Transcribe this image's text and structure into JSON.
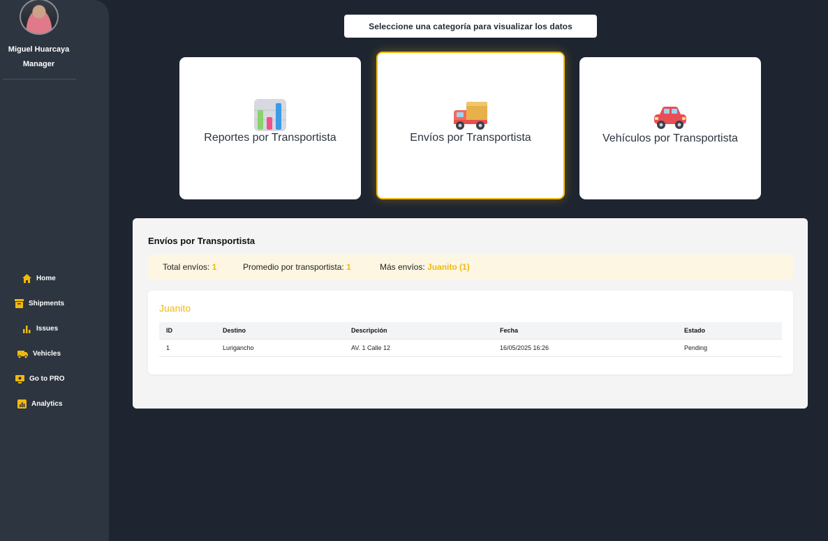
{
  "user": {
    "name": "Miguel Huarcaya",
    "role": "Manager"
  },
  "nav": [
    {
      "label": "Home",
      "icon": "home-icon"
    },
    {
      "label": "Shipments",
      "icon": "box-icon"
    },
    {
      "label": "Issues",
      "icon": "bar-chart-icon"
    },
    {
      "label": "Vehicles",
      "icon": "truck-icon"
    },
    {
      "label": "Go to PRO",
      "icon": "monitor-icon"
    },
    {
      "label": "Analytics",
      "icon": "analytics-icon"
    }
  ],
  "prompt": "Seleccione una categoría para visualizar los datos",
  "cards": [
    {
      "label": "Reportes por Transportista",
      "icon": "bar-chart-emoji-icon"
    },
    {
      "label": "Envíos por Transportista",
      "icon": "delivery-truck-emoji-icon",
      "selected": true
    },
    {
      "label": "Vehículos por Transportista",
      "icon": "car-emoji-icon"
    }
  ],
  "panel": {
    "title": "Envíos por Transportista",
    "summary": {
      "total_label": "Total envíos:",
      "total_value": "1",
      "avg_label": "Promedio por transportista:",
      "avg_value": "1",
      "max_label": "Más envíos:",
      "max_value": "Juanito (1)"
    },
    "carrier": "Juanito",
    "columns": [
      "ID",
      "Destino",
      "Descripción",
      "Fecha",
      "Estado"
    ],
    "rows": [
      [
        "1",
        "Lurigancho",
        "AV. 1 Calle 12",
        "16/05/2025 16:26",
        "Pending"
      ]
    ]
  },
  "colors": {
    "accent": "#f2b90d",
    "sidebar": "#2d3540",
    "background": "#1e2530"
  }
}
